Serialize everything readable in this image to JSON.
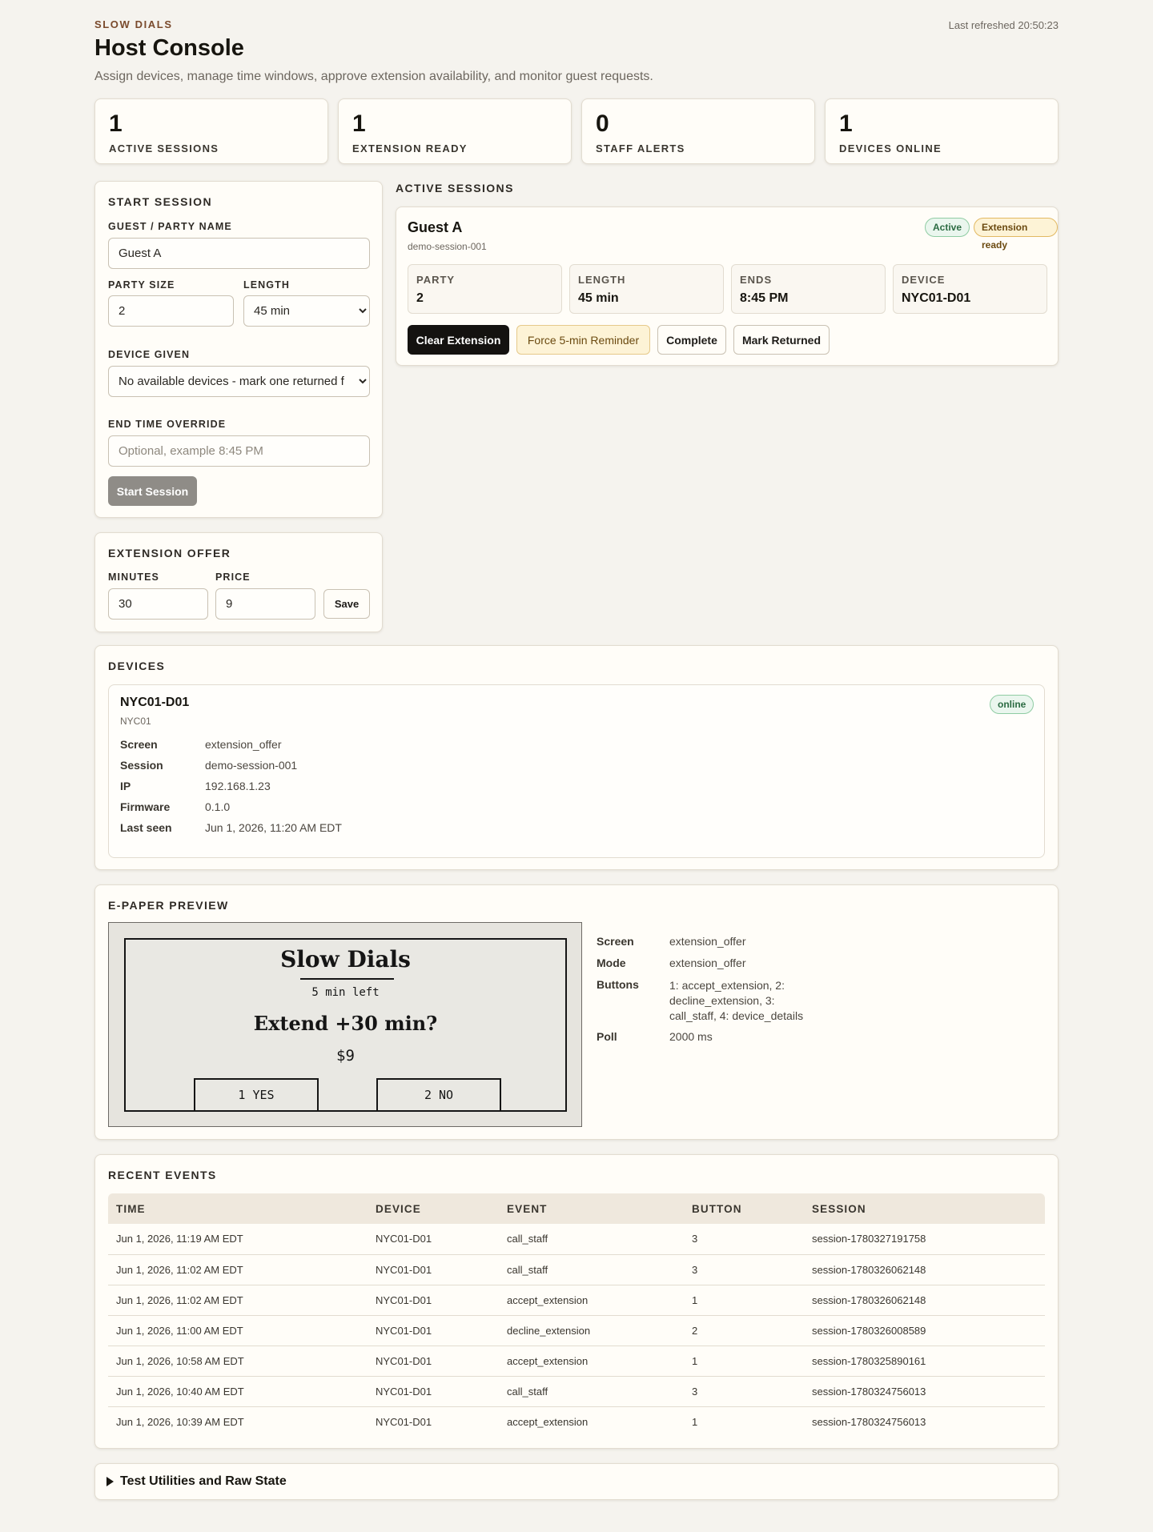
{
  "header": {
    "brand": "SLOW DIALS",
    "title": "Host Console",
    "subtitle": "Assign devices, manage time windows, approve extension availability, and monitor guest requests.",
    "last_refreshed": "Last refreshed 20:50:23"
  },
  "stats": [
    {
      "value": "1",
      "label": "ACTIVE SESSIONS"
    },
    {
      "value": "1",
      "label": "EXTENSION READY"
    },
    {
      "value": "0",
      "label": "STAFF ALERTS"
    },
    {
      "value": "1",
      "label": "DEVICES ONLINE"
    }
  ],
  "start_session": {
    "heading": "START SESSION",
    "guest_label": "GUEST / PARTY NAME",
    "guest_value": "Guest A",
    "party_size_label": "PARTY SIZE",
    "party_size_value": "2",
    "length_label": "LENGTH",
    "length_value": "45 min",
    "device_label": "DEVICE GIVEN",
    "device_value": "No available devices - mark one returned f",
    "end_time_label": "END TIME OVERRIDE",
    "end_time_placeholder": "Optional, example 8:45 PM",
    "start_button": "Start Session"
  },
  "extension_offer": {
    "heading": "EXTENSION OFFER",
    "minutes_label": "MINUTES",
    "minutes_value": "30",
    "price_label": "PRICE",
    "price_value": "9",
    "save_button": "Save"
  },
  "active_sessions": {
    "heading": "ACTIVE SESSIONS",
    "session": {
      "name": "Guest A",
      "id": "demo-session-001",
      "badges": {
        "active": "Active",
        "extension": "Extension ready"
      },
      "party_label": "PARTY",
      "party_value": "2",
      "length_label": "LENGTH",
      "length_value": "45 min",
      "ends_label": "ENDS",
      "ends_value": "8:45 PM",
      "device_label": "DEVICE",
      "device_value": "NYC01-D01",
      "actions": {
        "clear": "Clear Extension",
        "force": "Force 5-min Reminder",
        "complete": "Complete",
        "returned": "Mark Returned"
      },
      "colors": {
        "active": "#2b6b42",
        "extension": "#6b4a10"
      }
    }
  },
  "devices": {
    "heading": "DEVICES",
    "device": {
      "name": "NYC01-D01",
      "location": "NYC01",
      "status": "online",
      "fields": [
        {
          "key": "Screen",
          "value": "extension_offer"
        },
        {
          "key": "Session",
          "value": "demo-session-001"
        },
        {
          "key": "IP",
          "value": "192.168.1.23"
        },
        {
          "key": "Firmware",
          "value": "0.1.0"
        },
        {
          "key": "Last seen",
          "value": "Jun 1, 2026, 11:20 AM EDT"
        }
      ]
    }
  },
  "epaper": {
    "heading": "E-PAPER PREVIEW",
    "screen": {
      "title": "Slow Dials",
      "time_left": "5 min left",
      "offer": "Extend +30 min?",
      "price": "$9",
      "yes": "1 YES",
      "no": "2 NO"
    },
    "fields": [
      {
        "key": "Screen",
        "value": "extension_offer"
      },
      {
        "key": "Mode",
        "value": "extension_offer"
      },
      {
        "key": "Buttons",
        "value": "1: accept_extension, 2: decline_extension, 3: call_staff, 4: device_details"
      },
      {
        "key": "Poll",
        "value": "2000 ms"
      }
    ]
  },
  "events": {
    "heading": "RECENT EVENTS",
    "columns": [
      "TIME",
      "DEVICE",
      "EVENT",
      "BUTTON",
      "SESSION"
    ],
    "rows": [
      [
        "Jun 1, 2026, 11:19 AM EDT",
        "NYC01-D01",
        "call_staff",
        "3",
        "session-1780327191758"
      ],
      [
        "Jun 1, 2026, 11:02 AM EDT",
        "NYC01-D01",
        "call_staff",
        "3",
        "session-1780326062148"
      ],
      [
        "Jun 1, 2026, 11:02 AM EDT",
        "NYC01-D01",
        "accept_extension",
        "1",
        "session-1780326062148"
      ],
      [
        "Jun 1, 2026, 11:00 AM EDT",
        "NYC01-D01",
        "decline_extension",
        "2",
        "session-1780326008589"
      ],
      [
        "Jun 1, 2026, 10:58 AM EDT",
        "NYC01-D01",
        "accept_extension",
        "1",
        "session-1780325890161"
      ],
      [
        "Jun 1, 2026, 10:40 AM EDT",
        "NYC01-D01",
        "call_staff",
        "3",
        "session-1780324756013"
      ],
      [
        "Jun 1, 2026, 10:39 AM EDT",
        "NYC01-D01",
        "accept_extension",
        "1",
        "session-1780324756013"
      ]
    ]
  },
  "utilities": {
    "label": "Test Utilities and Raw State"
  }
}
